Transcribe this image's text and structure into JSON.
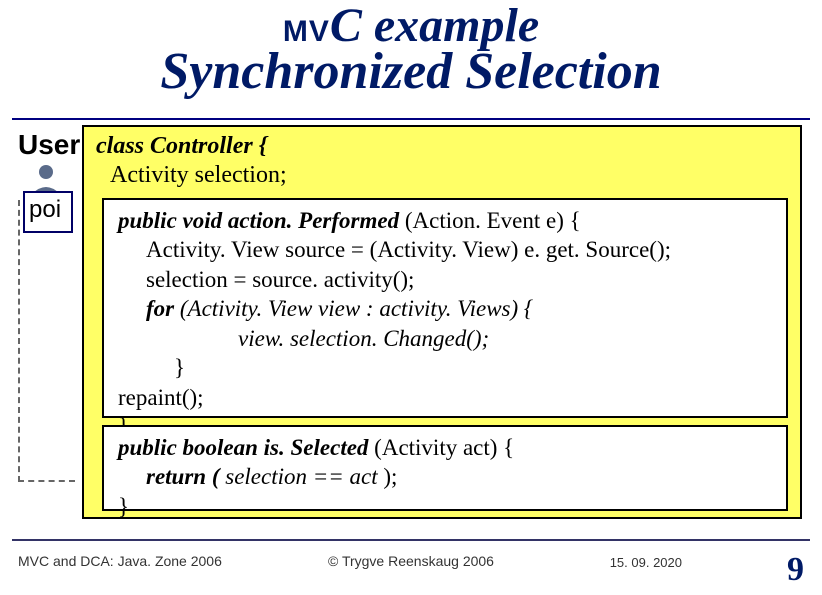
{
  "title": {
    "small": "MV",
    "big": "C example",
    "sub": "Synchronized Selection"
  },
  "user_label": "User",
  "poi_text": "poi",
  "class_decl": "class Controller {",
  "field_decl": "Activity selection;",
  "code1": {
    "l1a": "public void ",
    "l1b": "action. Performed ",
    "l1c": "(Action. Event e) {",
    "l2": "Activity. View source = (Activity. View) e. get. Source();",
    "l3": "selection = source. activity();",
    "l4a": "for ",
    "l4b": "(Activity. View view : activity. Views) {",
    "l5": "view. selection. Changed();",
    "l6": "}",
    "l7": "repaint();",
    "l8": "}"
  },
  "code2": {
    "l1a": "public boolean ",
    "l1b": "is. Selected ",
    "l1c": "(Activity act) {",
    "l2a": "return ( ",
    "l2b": "selection == act ",
    "l2c": ");",
    "l3": "}"
  },
  "footer": {
    "left": "MVC and DCA:  Java. Zone 2006",
    "center": "© Trygve Reenskaug 2006",
    "date": "15. 09. 2020",
    "page": "9"
  }
}
